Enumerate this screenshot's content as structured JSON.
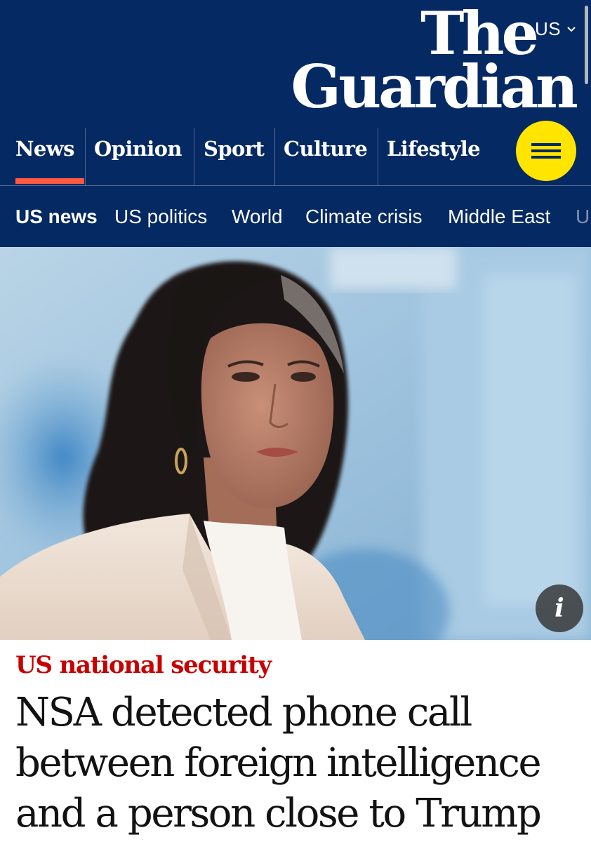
{
  "header": {
    "edition": "US",
    "logo_line1": "The",
    "logo_line2": "Guardian",
    "brand_color": "#052962"
  },
  "pillars": [
    {
      "label": "News",
      "active": true
    },
    {
      "label": "Opinion",
      "active": false
    },
    {
      "label": "Sport",
      "active": false
    },
    {
      "label": "Culture",
      "active": false
    },
    {
      "label": "Lifestyle",
      "active": false
    }
  ],
  "menu_button": {
    "icon": "hamburger-icon",
    "color": "#ffe500"
  },
  "subnav": [
    {
      "label": "US news",
      "active": true
    },
    {
      "label": "US politics",
      "active": false
    },
    {
      "label": "World",
      "active": false
    },
    {
      "label": "Climate crisis",
      "active": false
    },
    {
      "label": "Middle East",
      "active": false
    },
    {
      "label": "U",
      "active": false
    }
  ],
  "hero": {
    "info_label": "i"
  },
  "article": {
    "kicker": "US national security",
    "kicker_color": "#c70000",
    "headline": "NSA detected phone call between foreign intelligence and a person close to Trump"
  }
}
